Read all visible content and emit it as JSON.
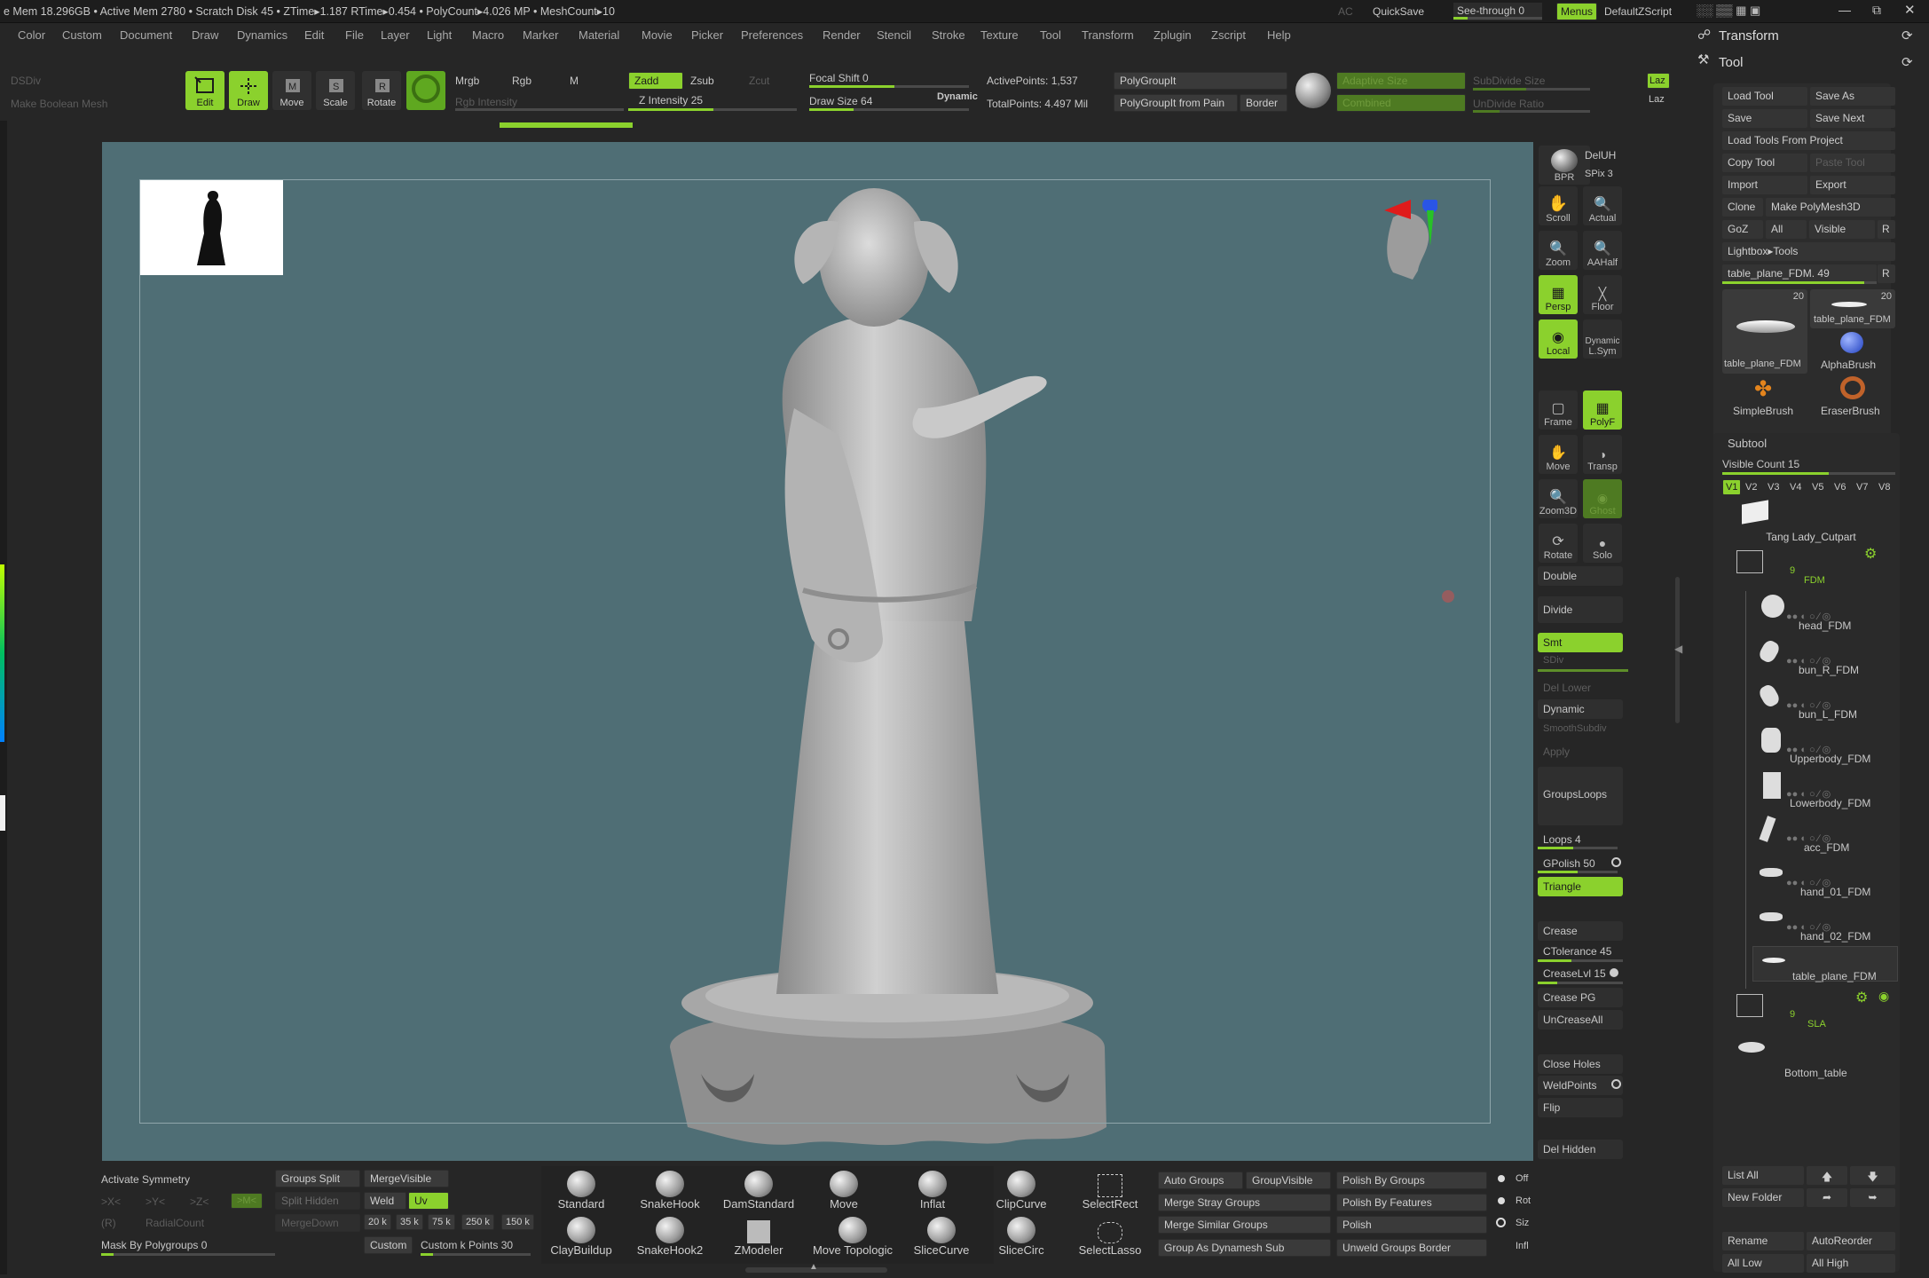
{
  "topbar": {
    "stats": "e Mem 18.296GB • Active Mem 2780 • Scratch Disk 45 • ZTime▸1.187 RTime▸0.454 • PolyCount▸4.026 MP • MeshCount▸10",
    "ac": "AC",
    "quicksave": "QuickSave",
    "see_through": "See-through  0",
    "menus": "Menus",
    "default_zscript": "DefaultZScript"
  },
  "menu_items": [
    "Color",
    "Custom",
    "Document",
    "Draw",
    "Dynamics",
    "Edit",
    "File",
    "Layer",
    "Light",
    "Macro",
    "Marker",
    "Material",
    "Movie",
    "Picker",
    "Preferences",
    "Render",
    "Stencil",
    "Stroke",
    "Texture",
    "Tool",
    "Transform",
    "Zplugin",
    "Zscript",
    "Help"
  ],
  "panel_headers": {
    "transform": "Transform",
    "tool": "Tool"
  },
  "left_top": {
    "dsdiv": "DSDiv",
    "make_boolean": "Make Boolean Mesh"
  },
  "toolbar": {
    "edit": "Edit",
    "draw": "Draw",
    "move": "Move",
    "scale": "Scale",
    "rotate": "Rotate",
    "mrgb": "Mrgb",
    "rgb": "Rgb",
    "m": "M",
    "rgb_intensity": "Rgb Intensity",
    "zadd": "Zadd",
    "zsub": "Zsub",
    "zcut": "Zcut",
    "z_intensity": "Z Intensity 25",
    "focal_shift": "Focal Shift 0",
    "draw_size": "Draw Size 64",
    "dynamic": "Dynamic",
    "active_points": "ActivePoints: 1,537",
    "total_points": "TotalPoints: 4.497 Mil",
    "polygroupit": "PolyGroupIt",
    "polygroupit_paint": "PolyGroupIt from Pain",
    "border": "Border",
    "adaptive_size": "Adaptive Size",
    "combined": "Combined",
    "subdivide_size": "SubDivide Size",
    "undivide_ratio": "UnDivide Ratio",
    "laz1": "Laz",
    "laz2": "Laz"
  },
  "right_shelf": {
    "bpr": "BPR",
    "spix": "SPix 3",
    "scroll": "Scroll",
    "actual": "Actual",
    "zoom": "Zoom",
    "aahalf": "AAHalf",
    "persp": "Persp",
    "floor": "Floor",
    "local": "Local",
    "lsym": "L.Sym",
    "dynamic": "Dynamic",
    "frame": "Frame",
    "polyf": "PolyF",
    "move": "Move",
    "transp": "Transp",
    "zoom3d": "Zoom3D",
    "ghost": "Ghost",
    "rotate": "Rotate",
    "solo": "Solo",
    "delUH": "DelUH"
  },
  "geometry_buttons": {
    "double": "Double",
    "divide": "Divide",
    "smt": "Smt",
    "sdiv": "SDiv",
    "del_lower": "Del Lower",
    "dynamic": "Dynamic",
    "smooth_subdiv": "SmoothSubdiv",
    "apply": "Apply",
    "groups_loops": "GroupsLoops",
    "loops": "Loops 4",
    "gpolish": "GPolish 50",
    "triangle": "Triangle",
    "crease": "Crease",
    "ctolerance": "CTolerance 45",
    "creaselvl": "CreaseLvl 15",
    "crease_pg": "Crease PG",
    "uncrease_all": "UnCreaseAll",
    "close_holes": "Close Holes",
    "weld_points": "WeldPoints",
    "flip": "Flip",
    "del_hidden": "Del Hidden"
  },
  "tool_panel": {
    "load_tool": "Load Tool",
    "save_as": "Save As",
    "save": "Save",
    "save_next": "Save Next",
    "load_tools_from_project": "Load Tools From Project",
    "copy_tool": "Copy Tool",
    "paste_tool": "Paste Tool",
    "import": "Import",
    "export": "Export",
    "clone": "Clone",
    "make_polymesh": "Make PolyMesh3D",
    "goz": "GoZ",
    "all": "All",
    "visible": "Visible",
    "r": "R",
    "lightbox_tools": "Lightbox▸Tools",
    "current_tool": "table_plane_FDM. 49",
    "thumb1_count": "20",
    "thumb2_count": "20",
    "thumb1_name": "table_plane_FDM",
    "thumb2_name": "table_plane_FDM",
    "alpha_brush": "AlphaBrush",
    "simple_brush": "SimpleBrush",
    "eraser_brush": "EraserBrush"
  },
  "subtool": {
    "header": "Subtool",
    "visible_count": "Visible Count 15",
    "versions": [
      "V1",
      "V2",
      "V3",
      "V4",
      "V5",
      "V6",
      "V7",
      "V8"
    ],
    "top_item": "Tang Lady_Cutpart",
    "folder1_count": "9",
    "folder1_name": "FDM",
    "items": [
      "head_FDM",
      "bun_R_FDM",
      "bun_L_FDM",
      "Upperbody_FDM",
      "Lowerbody_FDM",
      "acc_FDM",
      "hand_01_FDM",
      "hand_02_FDM",
      "table_plane_FDM"
    ],
    "folder2_count": "9",
    "folder2_name": "SLA",
    "bottom_item": "Bottom_table",
    "list_all": "List All",
    "new_folder": "New Folder",
    "rename": "Rename",
    "auto_reorder": "AutoReorder",
    "all_low": "All Low",
    "all_high": "All High"
  },
  "bottom": {
    "activate_symmetry": "Activate Symmetry",
    "x": ">X<",
    "y": ">Y<",
    "z": ">Z<",
    "m": ">M<",
    "r": "(R)",
    "radial_count": "RadialCount",
    "mask_by_polygroups": "Mask By Polygroups 0",
    "groups_split": "Groups Split",
    "split_hidden": "Split Hidden",
    "merge_visible": "MergeVisible",
    "merge_down": "MergeDown",
    "weld": "Weld",
    "uv": "Uv",
    "k20": "20 k",
    "k35": "35 k",
    "k75": "75 k",
    "k250": "250 k",
    "k150": "150 k",
    "custom": "Custom",
    "custom_k_points": "Custom k Points 30",
    "brushes_row1": [
      "Standard",
      "SnakeHook",
      "DamStandard",
      "Move",
      "Inflat",
      "ClipCurve",
      "SelectRect"
    ],
    "brushes_row2": [
      "ClayBuildup",
      "SnakeHook2",
      "ZModeler",
      "Move Topologic",
      "SliceCurve",
      "SliceCirc",
      "SelectLasso"
    ],
    "auto_groups": "Auto Groups",
    "group_visible": "GroupVisible",
    "merge_stray_groups": "Merge Stray Groups",
    "merge_similar_groups": "Merge Similar Groups",
    "group_as_dynamesh_sub": "Group As Dynamesh Sub",
    "polish_by_groups": "Polish By Groups",
    "polish_by_features": "Polish By Features",
    "polish": "Polish",
    "unweld_groups_border": "Unweld Groups Border",
    "off": "Off",
    "rot": "Rot",
    "siz": "Siz",
    "inf": "Infl"
  },
  "colors": {
    "accent": "#8bd12d",
    "viewport": "#4f6e75",
    "background": "#262626"
  }
}
